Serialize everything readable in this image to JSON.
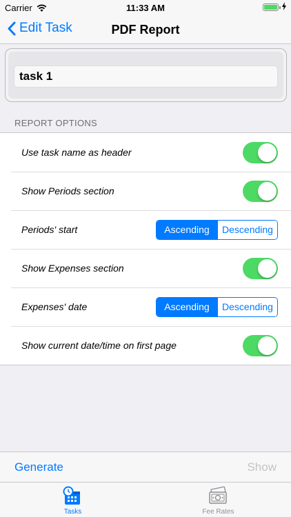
{
  "status_bar": {
    "carrier": "Carrier",
    "time": "11:33 AM"
  },
  "nav": {
    "back_label": "Edit Task",
    "title": "PDF Report"
  },
  "task_name": {
    "value": "task 1"
  },
  "section": {
    "header": "REPORT OPTIONS"
  },
  "options": [
    {
      "label": "Use task name as header",
      "control": "toggle",
      "on": true
    },
    {
      "label": "Show Periods section",
      "control": "toggle",
      "on": true
    },
    {
      "label": "Periods' start",
      "control": "segment",
      "choices": [
        "Ascending",
        "Descending"
      ],
      "selected": "Ascending"
    },
    {
      "label": "Show Expenses section",
      "control": "toggle",
      "on": true
    },
    {
      "label": "Expenses' date",
      "control": "segment",
      "choices": [
        "Ascending",
        "Descending"
      ],
      "selected": "Ascending"
    },
    {
      "label": "Show current date/time on first page",
      "control": "toggle",
      "on": true
    }
  ],
  "toolbar": {
    "generate_label": "Generate",
    "show_label": "Show"
  },
  "tabs": [
    {
      "label": "Tasks",
      "icon": "calendar-clock-icon",
      "selected": true
    },
    {
      "label": "Fee Rates",
      "icon": "money-icon",
      "selected": false
    }
  ],
  "colors": {
    "accent": "#007aff",
    "toggle_on": "#4cd964",
    "background": "#efeff4"
  }
}
